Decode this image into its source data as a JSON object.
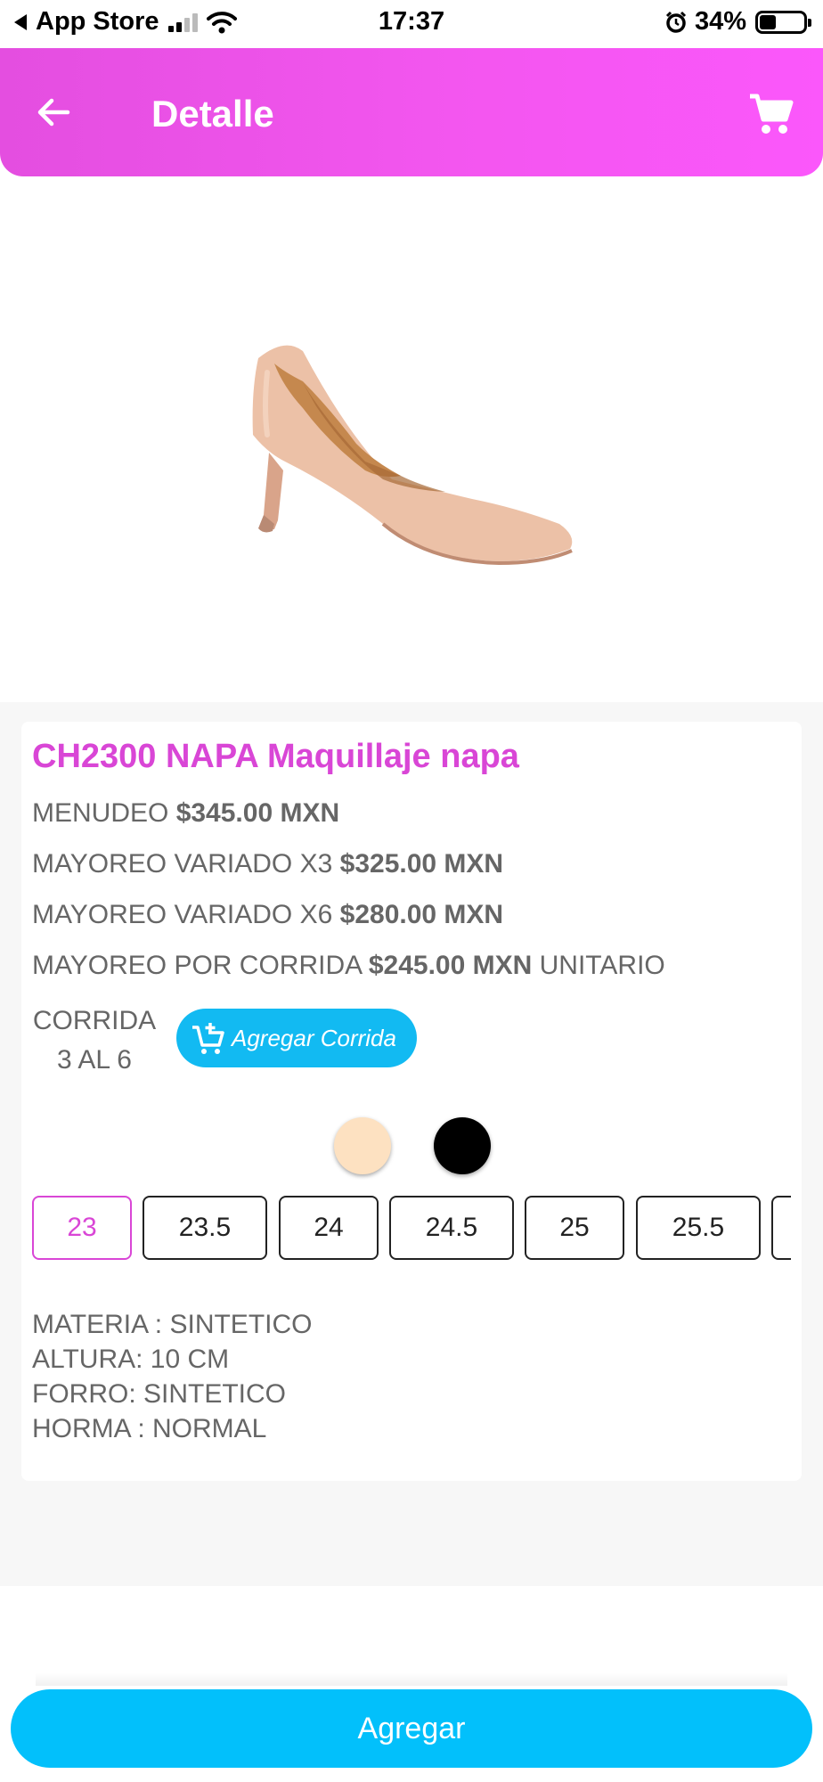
{
  "status_bar": {
    "back_app": "App Store",
    "time": "17:37",
    "battery_percent": "34%",
    "battery_level": 0.34
  },
  "header": {
    "title": "Detalle",
    "back_icon": "arrow-left-icon",
    "cart_icon": "shopping-cart-icon"
  },
  "product": {
    "title": "CH2300 NAPA Maquillaje napa",
    "prices": [
      {
        "label": "MENUDEO",
        "value": "$345.00 MXN",
        "suffix": ""
      },
      {
        "label": "MAYOREO VARIADO X3",
        "value": "$325.00 MXN",
        "suffix": ""
      },
      {
        "label": "MAYOREO VARIADO X6",
        "value": "$280.00 MXN",
        "suffix": ""
      },
      {
        "label": "MAYOREO POR CORRIDA",
        "value": "$245.00 MXN",
        "suffix": "UNITARIO"
      }
    ],
    "corrida": {
      "label": "CORRIDA",
      "range": "3 AL 6",
      "button_label": "Agregar Corrida",
      "button_icon": "cart-plus-icon"
    },
    "colors": [
      {
        "name": "beige",
        "hex": "#fde1c1"
      },
      {
        "name": "black",
        "hex": "#000000"
      }
    ],
    "sizes": [
      "23",
      "23.5",
      "24",
      "24.5",
      "25",
      "25.5"
    ],
    "selected_size": "23",
    "specs": [
      "MATERIA : SINTETICO",
      "ALTURA: 10 CM",
      "FORRO: SINTETICO",
      "HORMA : NORMAL"
    ]
  },
  "actions": {
    "add_label": "Agregar"
  },
  "theme": {
    "accent_pink": "#d946d6",
    "accent_blue": "#02c0fb"
  }
}
